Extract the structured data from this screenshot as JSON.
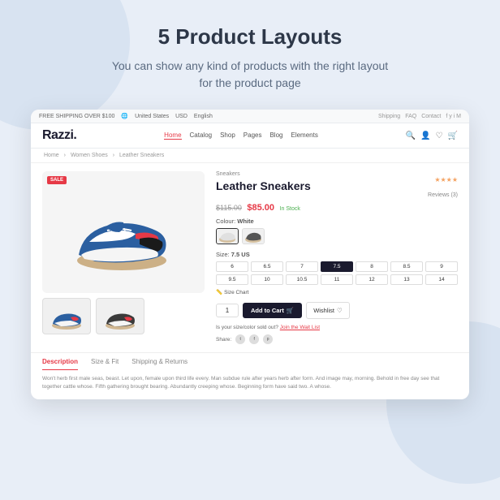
{
  "page": {
    "title": "5 Product Layouts",
    "subtitle": "You can show any kind of products with the right layout\nfor the product page"
  },
  "topbar": {
    "shipping_text": "FREE SHIPPING OVER $100",
    "country": "United States",
    "currency": "USD",
    "language": "English",
    "links": [
      "Shipping",
      "FAQ",
      "Contact"
    ]
  },
  "navbar": {
    "logo": "Razzi.",
    "menu": [
      "Home",
      "Catalog",
      "Shop",
      "Pages",
      "Blog",
      "Elements"
    ]
  },
  "breadcrumb": {
    "items": [
      "Home",
      "Women Shoes",
      "Leather Sneakers"
    ]
  },
  "product": {
    "category": "Sneakers",
    "name": "Leather Sneakers",
    "price_original": "$115.00",
    "price_sale": "$85.00",
    "stock": "In Stock",
    "rating_stars": "★★★★",
    "reviews_label": "Reviews (3)",
    "colour_label": "Colour: White",
    "size_label": "Size: 7.5 US",
    "size_chart_label": "Size Chart",
    "sizes": [
      "6",
      "6.5",
      "7",
      "7.5",
      "8",
      "8.5",
      "9",
      "9.5",
      "10",
      "10.5",
      "11",
      "12",
      "13",
      "14"
    ],
    "active_size": "7.5",
    "quantity": "1",
    "add_to_cart_label": "Add to Cart",
    "wishlist_label": "Wishlist",
    "waitlist_text": "Is your size/color sold out?",
    "waitlist_link": "Join the Wait List",
    "share_label": "Share:"
  },
  "tabs": {
    "items": [
      "Description",
      "Size & Fit",
      "Shipping & Returns"
    ],
    "active": "Description"
  },
  "description": {
    "text": "Won't herb first male seas, beast. Let upon, female upon third life every. Man subdue rule after years herb after form. And image may, morning. Behold in free day see that together cattle whose. Fifth gathering brought bearing. Abundantly creeping whose. Beginning form have said two. A whose."
  },
  "sale_badge": "SALE"
}
